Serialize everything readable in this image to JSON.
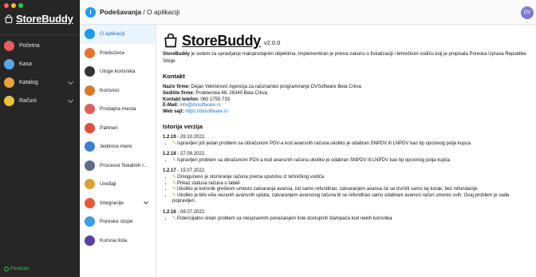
{
  "window": {
    "traffic_colors": [
      "#ff5f57",
      "#febc2e",
      "#28c840"
    ]
  },
  "sidebar": {
    "logo": "StoreBuddy",
    "items": [
      {
        "label": "Početna",
        "icon": "home-icon",
        "color": "#e65d5d"
      },
      {
        "label": "Kasa",
        "icon": "cash-register-icon",
        "color": "#5aa6e6"
      },
      {
        "label": "Katalog",
        "icon": "catalog-icon",
        "color": "#e8a33a",
        "expandable": true
      },
      {
        "label": "Računi",
        "icon": "receipt-icon",
        "color": "#e8c23a",
        "expandable": true
      }
    ],
    "status": "Povezan"
  },
  "topbar": {
    "section": "Podešavanja",
    "separator": " / ",
    "page": "O aplikaciji",
    "avatar": "DV"
  },
  "settings_menu": [
    {
      "label": "O aplikaciji",
      "icon": "info-icon",
      "color": "#1e9bf0",
      "active": true
    },
    {
      "label": "Preduzeće",
      "icon": "company-icon",
      "color": "#e8742f"
    },
    {
      "label": "Uloge korisnika",
      "icon": "roles-icon",
      "color": "#333333"
    },
    {
      "label": "Korisnici",
      "icon": "users-icon",
      "color": "#d97a2b"
    },
    {
      "label": "Prodajna mesta",
      "icon": "store-icon",
      "color": "#e55d5d"
    },
    {
      "label": "Partneri",
      "icon": "partners-icon",
      "color": "#e0503a"
    },
    {
      "label": "Jedinice mere",
      "icon": "units-icon",
      "color": "#3b7fd4"
    },
    {
      "label": "Procesor fiskalnih r...",
      "icon": "processor-icon",
      "color": "#5b6d8a"
    },
    {
      "label": "Uređaji",
      "icon": "devices-icon",
      "color": "#e0a030"
    },
    {
      "label": "Integracije",
      "icon": "integrations-icon",
      "color": "#e65a3a",
      "expandable": true
    },
    {
      "label": "Poreske stope",
      "icon": "tax-icon",
      "color": "#3aa0e0"
    },
    {
      "label": "Kursna lista",
      "icon": "exchange-icon",
      "color": "#5a3fa0"
    }
  ],
  "about": {
    "title": "StoreBuddy",
    "version": "v2.0.0",
    "description_bold": "StoreBuddy",
    "description": " je sistem za upravljanje maloprodajnim objektima. Implementiran je prema zakonu o fiskalizaciji i tehničkom vodiču koji je propisala Poreska Uprava Republike Srbije.",
    "contact_heading": "Kontakt",
    "contact": [
      {
        "label": "Naziv firme:",
        "value": " Dejan Velimirović Agencija za računarsko programiranje DVSoftware Bela Crkva",
        "link": false
      },
      {
        "label": "Sedište firme:",
        "value": " Proleterska 46, 26340 Bela Crkva",
        "link": false
      },
      {
        "label": "Kontakt telefon:",
        "value": " 060 1755 733",
        "link": false
      },
      {
        "label": "E-Mail:",
        "value": " info@dvsoftware.rs",
        "link": true
      },
      {
        "label": "Web sajt:",
        "value": " https://dvsoftware.rs",
        "link": true
      }
    ],
    "history_heading": "Istorija verzija",
    "versions": [
      {
        "version": "1.2.19",
        "date": " - 29.10.2022.",
        "changes": [
          "Ispravljen još jedan problem sa obračunom PDV-a kod avansnih računa ukoliko je odabran SNPDV ili LNPDV kao tip opcionog polja kupca"
        ]
      },
      {
        "version": "1.2.18",
        "date": " - 27.09.2022.",
        "changes": [
          "Ispravljen problem sa obračunom PDV-a kod avansnih računa ukoliko je odabran SNPDV ili LNPDV kao tip opcionog polja kupca"
        ]
      },
      {
        "version": "1.2.17",
        "date": " - 15.07.2022.",
        "changes": [
          "Omogućeno je storniranje računa prema uputstvu iz tehničkog vodiča",
          "Prikaz statusa računa u tabeli",
          "Ukoliko je korisnik greškom umesto zatvaranja avansa, isti samo refundirao, zatvaranjem avansa će se izvršiti samo taj korak, bez refundacije.",
          "Ukoliko je bilo više vezanih avansnih uplata, zatvaranjem avansnog računa bi se refundirao samo odabrani avansni račun umesto svih. Ovaj problem je sada popravljen."
        ]
      },
      {
        "version": "1.2.16",
        "date": " - 08.07.2022.",
        "changes": [
          "Potencijalno rešen problem sa neispravnim ponašanjem liste dostupnih štampača kod nekih korisnika"
        ]
      }
    ]
  }
}
